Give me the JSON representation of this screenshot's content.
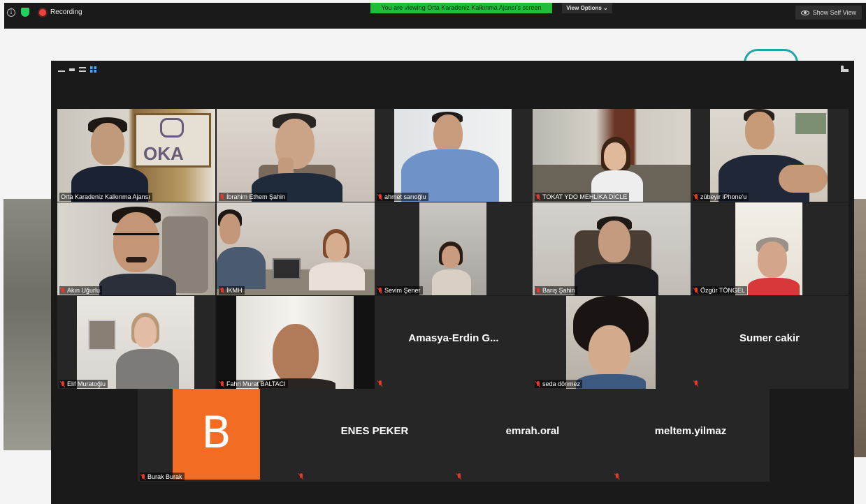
{
  "top_bar": {
    "recording_label": "Recording",
    "share_banner": "You are viewing Orta Karadeniz Kalkınma Ajansı's screen",
    "view_options": "View Options ⌄",
    "show_self_view": "Show Self View"
  },
  "participants": [
    {
      "name": "Orta Karadeniz Kalkınma Ajansı",
      "video": true,
      "active_speaker": true
    },
    {
      "name": "İbrahim Ethem Şahin",
      "video": true
    },
    {
      "name": "ahmet sarıoğlu",
      "video": true
    },
    {
      "name": "TOKAT YDO MEHLİKA DİCLE",
      "video": true
    },
    {
      "name": "zübeyir iPhone'u",
      "video": true
    },
    {
      "name": "Akın Uğurlu",
      "video": true
    },
    {
      "name": "İKMH",
      "video": true
    },
    {
      "name": "Sevim Şener",
      "video": true
    },
    {
      "name": "Barış Şahin",
      "video": true
    },
    {
      "name": "Özgür TÖNGEL",
      "video": true
    },
    {
      "name": "Elif Muratoğlu",
      "video": true
    },
    {
      "name": "Fahri Murat BALTACI",
      "video": true
    },
    {
      "name": "Amasya-Erdin G...",
      "video": false
    },
    {
      "name": "seda dönmez",
      "video": true
    },
    {
      "name": "Sumer cakir",
      "video": false
    },
    {
      "name": "Burak Burak",
      "video": false,
      "avatar_letter": "B",
      "avatar_color": "#f36c23"
    },
    {
      "name": "ENES PEKER",
      "video": false
    },
    {
      "name": "emrah.oral",
      "video": false
    },
    {
      "name": "meltem.yilmaz",
      "video": false
    }
  ],
  "colors": {
    "banner_green": "#1fbd3a",
    "muted_red": "#e0392b",
    "active_outline": "#c6dc4a"
  }
}
